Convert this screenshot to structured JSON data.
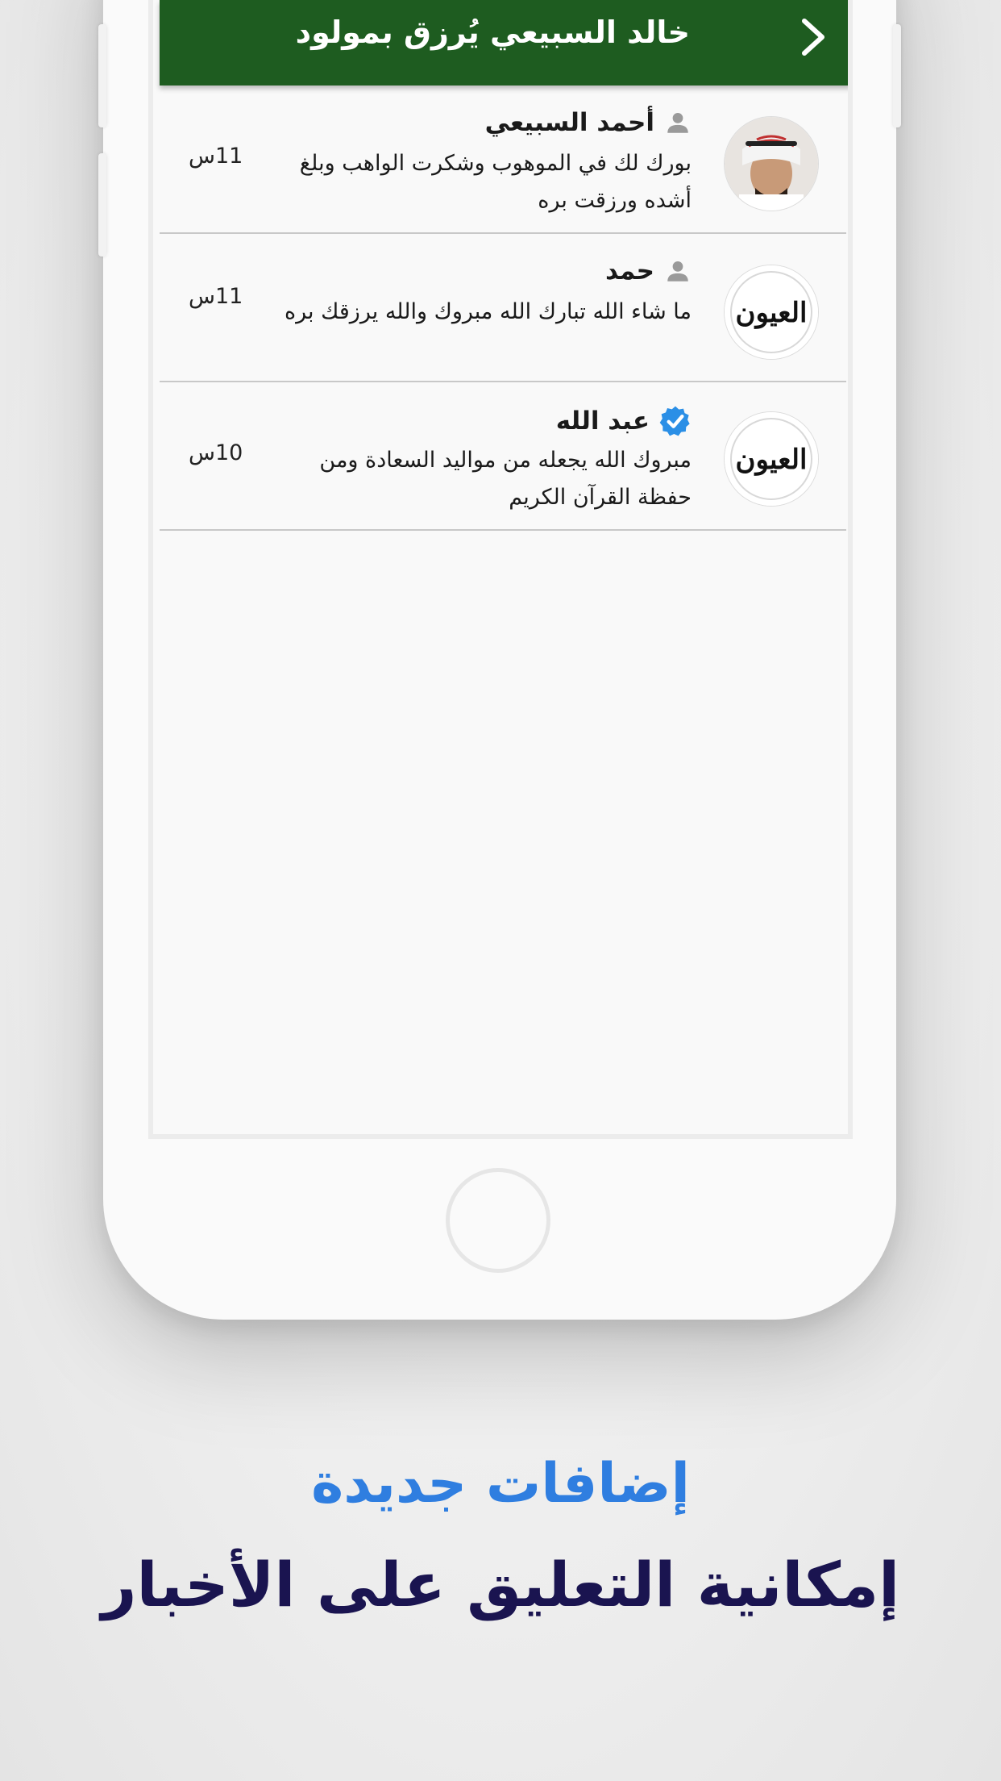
{
  "app_bar": {
    "title": "خالد السبيعي يُرزق بمولود",
    "back_icon": "chevron-right-icon",
    "color": "#1e5c20"
  },
  "comments": [
    {
      "author": "أحمد السبيعي",
      "author_icon": "person-icon",
      "avatar": "photo",
      "text": "بورك لك في الموهوب وشكرت الواهب وبلغ أشده ورزقت بره",
      "time": "11س"
    },
    {
      "author": "حمد",
      "author_icon": "person-icon",
      "avatar": "logo",
      "avatar_logo_text": "العيون",
      "text": "ما شاء الله تبارك الله مبروك والله يرزقك بره",
      "time": "11س"
    },
    {
      "author": "عبد الله",
      "author_icon": "verified-badge-icon",
      "avatar": "logo",
      "avatar_logo_text": "العيون",
      "text": "مبروك الله يجعله من مواليد السعادة ومن حفظة القرآن الكريم",
      "time": "10س"
    }
  ],
  "captions": {
    "headline": "إضافات جديدة",
    "subline": "إمكانية التعليق على الأخبار",
    "headline_color": "#2f7ee0",
    "subline_color": "#1a1450"
  }
}
